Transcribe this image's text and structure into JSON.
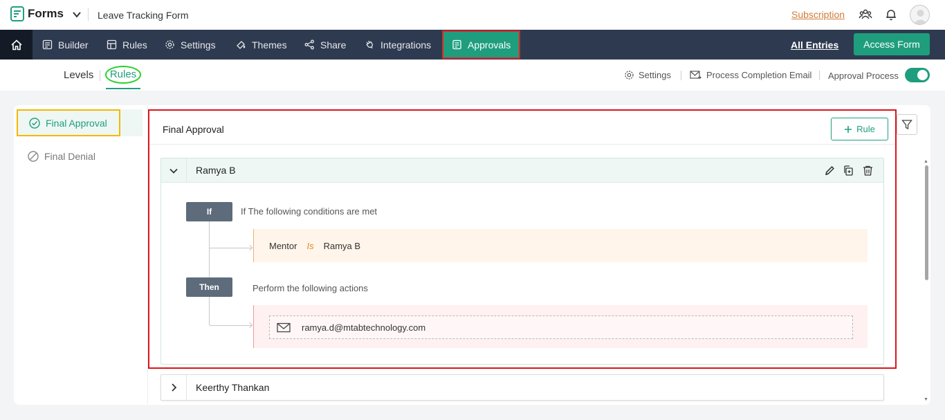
{
  "topbar": {
    "app_name": "Forms",
    "form_title": "Leave Tracking Form",
    "subscription": "Subscription"
  },
  "nav": {
    "items": [
      {
        "label": "Builder",
        "icon": "builder-icon"
      },
      {
        "label": "Rules",
        "icon": "rules-icon"
      },
      {
        "label": "Settings",
        "icon": "gear-icon"
      },
      {
        "label": "Themes",
        "icon": "paint-icon"
      },
      {
        "label": "Share",
        "icon": "share-icon"
      },
      {
        "label": "Integrations",
        "icon": "plug-icon"
      },
      {
        "label": "Approvals",
        "icon": "approvals-icon"
      }
    ],
    "all_entries": "All Entries",
    "access_form": "Access Form",
    "colors": {
      "bar": "#2e3a4f",
      "accent": "#1f9e7e",
      "highlight": "#e0242a"
    }
  },
  "subbar": {
    "levels": "Levels",
    "rules": "Rules",
    "settings": "Settings",
    "process_email": "Process Completion Email",
    "approval_process": "Approval Process",
    "approval_process_enabled": true
  },
  "sidebar": {
    "items": [
      {
        "label": "Final Approval",
        "icon": "check-circle-icon",
        "active": true
      },
      {
        "label": "Final Denial",
        "icon": "ban-icon",
        "active": false
      }
    ]
  },
  "section": {
    "title": "Final Approval",
    "add_rule": "Rule"
  },
  "rules": [
    {
      "name": "Ramya B",
      "expanded": true,
      "if_tag": "If",
      "if_text": "If The following conditions are met",
      "condition": {
        "field": "Mentor",
        "operator": "Is",
        "value": "Ramya B"
      },
      "then_tag": "Then",
      "then_text": "Perform the following actions",
      "action_email": "ramya.d@mtabtechnology.com"
    },
    {
      "name": "Keerthy Thankan",
      "expanded": false
    }
  ]
}
